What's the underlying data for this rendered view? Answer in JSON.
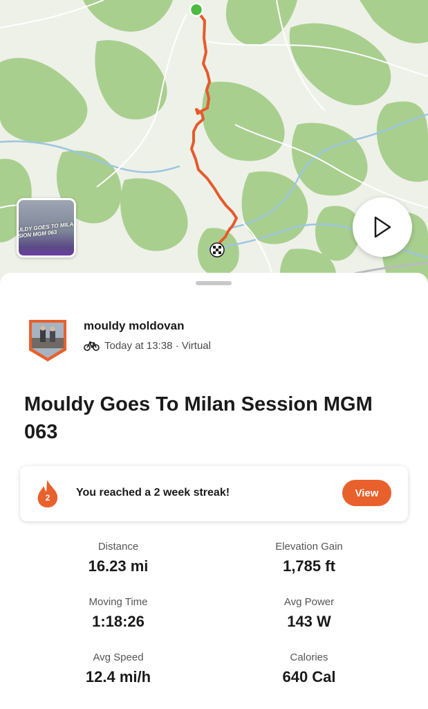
{
  "map": {
    "thumbnail_text": "ULDY GOES TO MILAN\nSION MGM 063",
    "route_color": "#e55a2b",
    "start_color": "#4cbb3f",
    "play_icon": "play-icon"
  },
  "activity": {
    "athlete_name": "mouldy moldovan",
    "activity_icon": "bicycle-icon",
    "datetime": "Today at 13:38 · Virtual",
    "title": "Mouldy Goes To Milan Session MGM 063"
  },
  "streak": {
    "icon": "flame-icon",
    "count": "2",
    "message": "You reached a 2 week streak!",
    "button_label": "View",
    "accent": "#e8602c"
  },
  "stats": [
    {
      "label": "Distance",
      "value": "16.23 mi"
    },
    {
      "label": "Elevation Gain",
      "value": "1,785 ft"
    },
    {
      "label": "Moving Time",
      "value": "1:18:26"
    },
    {
      "label": "Avg Power",
      "value": "143 W"
    },
    {
      "label": "Avg Speed",
      "value": "12.4 mi/h"
    },
    {
      "label": "Calories",
      "value": "640 Cal"
    }
  ]
}
